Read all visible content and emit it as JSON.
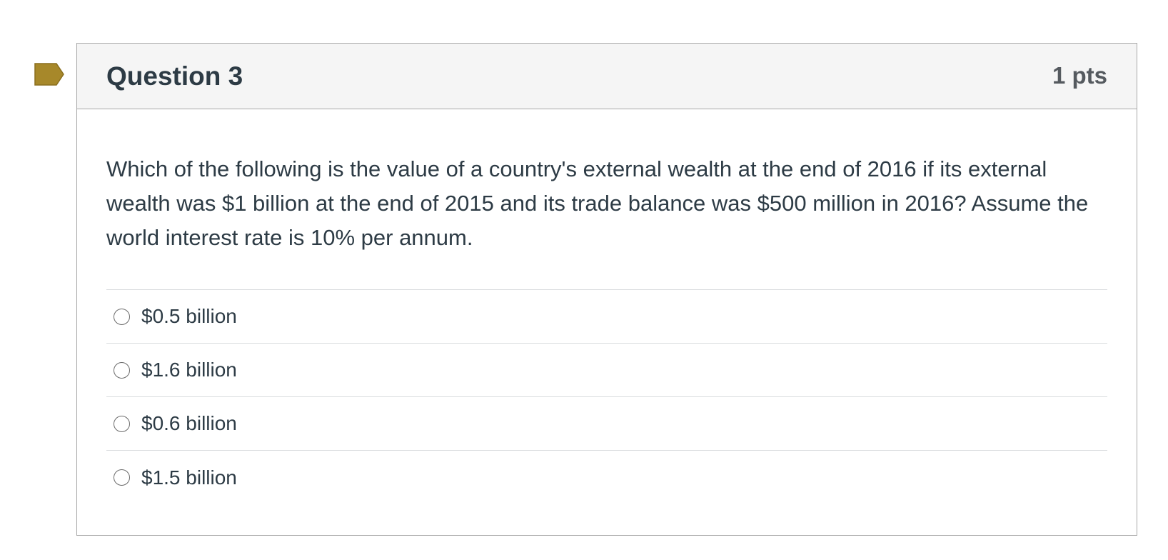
{
  "question": {
    "title": "Question 3",
    "points": "1 pts",
    "flag_color": "#a7882a",
    "text": "Which of the following is the value of a country's external wealth at the end of 2016 if its external wealth was $1 billion at the end of 2015 and its trade balance was $500 million in 2016? Assume the world interest rate is 10% per annum.",
    "answers": [
      {
        "label": "$0.5 billion",
        "selected": false
      },
      {
        "label": "$1.6 billion",
        "selected": false
      },
      {
        "label": "$0.6 billion",
        "selected": false
      },
      {
        "label": "$1.5 billion",
        "selected": false
      }
    ]
  }
}
